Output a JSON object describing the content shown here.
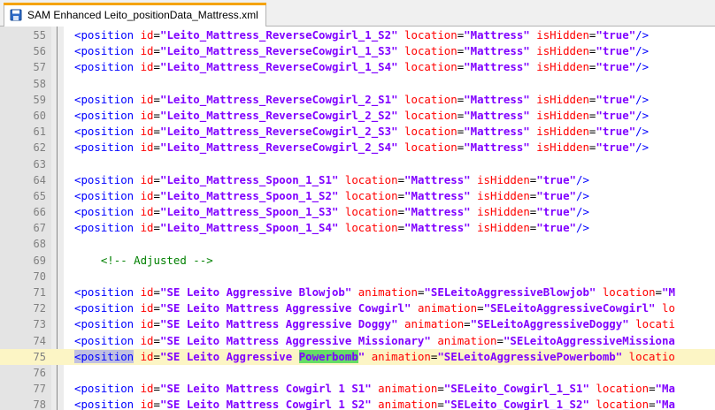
{
  "tab": {
    "title": "SAM Enhanced Leito_positionData_Mattress.xml",
    "accent_color": "#f5a300",
    "icon": "save-icon"
  },
  "colors": {
    "tag": "#0000ff",
    "attribute": "#ff0000",
    "value": "#8000ff",
    "comment": "#008000",
    "current_line": "#fcf5c5",
    "search_highlight": "#66dd66",
    "selection": "#c0c0e0"
  },
  "editor": {
    "lines": [
      {
        "n": "55",
        "type": "pos",
        "id": "\"Leito_Mattress_ReverseCowgirl_1_S2\"",
        "loc": "\"Mattress\"",
        "hidden": "\"true\"",
        "end": "/>"
      },
      {
        "n": "56",
        "type": "pos",
        "id": "\"Leito_Mattress_ReverseCowgirl_1_S3\"",
        "loc": "\"Mattress\"",
        "hidden": "\"true\"",
        "end": "/>"
      },
      {
        "n": "57",
        "type": "pos",
        "id": "\"Leito_Mattress_ReverseCowgirl_1_S4\"",
        "loc": "\"Mattress\"",
        "hidden": "\"true\"",
        "end": "/>"
      },
      {
        "n": "58",
        "type": "blank"
      },
      {
        "n": "59",
        "type": "pos",
        "id": "\"Leito_Mattress_ReverseCowgirl_2_S1\"",
        "loc": "\"Mattress\"",
        "hidden": "\"true\"",
        "end": "/>"
      },
      {
        "n": "60",
        "type": "pos",
        "id": "\"Leito_Mattress_ReverseCowgirl_2_S2\"",
        "loc": "\"Mattress\"",
        "hidden": "\"true\"",
        "end": "/>"
      },
      {
        "n": "61",
        "type": "pos",
        "id": "\"Leito_Mattress_ReverseCowgirl_2_S3\"",
        "loc": "\"Mattress\"",
        "hidden": "\"true\"",
        "end": "/>"
      },
      {
        "n": "62",
        "type": "pos",
        "id": "\"Leito_Mattress_ReverseCowgirl_2_S4\"",
        "loc": "\"Mattress\"",
        "hidden": "\"true\"",
        "end": "/>"
      },
      {
        "n": "63",
        "type": "blank"
      },
      {
        "n": "64",
        "type": "pos",
        "id": "\"Leito_Mattress_Spoon_1_S1\"",
        "loc": "\"Mattress\"",
        "hidden": "\"true\"",
        "end": "/>"
      },
      {
        "n": "65",
        "type": "pos",
        "id": "\"Leito_Mattress_Spoon_1_S2\"",
        "loc": "\"Mattress\"",
        "hidden": "\"true\"",
        "end": "/>"
      },
      {
        "n": "66",
        "type": "pos",
        "id": "\"Leito_Mattress_Spoon_1_S3\"",
        "loc": "\"Mattress\"",
        "hidden": "\"true\"",
        "end": "/>"
      },
      {
        "n": "67",
        "type": "pos",
        "id": "\"Leito_Mattress_Spoon_1_S4\"",
        "loc": "\"Mattress\"",
        "hidden": "\"true\"",
        "end": "/>"
      },
      {
        "n": "68",
        "type": "blank"
      },
      {
        "n": "69",
        "type": "comment",
        "text": "    <!-- Adjusted -->"
      },
      {
        "n": "70",
        "type": "blank"
      },
      {
        "n": "71",
        "type": "anim",
        "id": "\"SE Leito Aggressive Blowjob\"",
        "anim": "\"SELeitoAggressiveBlowjob\"",
        "loc": "\"M"
      },
      {
        "n": "72",
        "type": "anim",
        "id": "\"SE Leito Mattress Aggressive Cowgirl\"",
        "anim": "\"SELeitoAggressiveCowgirl\"",
        "loc": ""
      },
      {
        "n": "73",
        "type": "anim",
        "id": "\"SE Leito Mattress Aggressive Doggy\"",
        "anim": "\"SELeitoAggressiveDoggy\"",
        "loc": ""
      },
      {
        "n": "74",
        "type": "anim",
        "id": "\"SE Leito Mattress Aggressive Missionary\"",
        "anim": "\"SELeitoAggressiveMissiona",
        "loc": null
      },
      {
        "n": "75",
        "type": "current",
        "id_pre": "\"SE Leito Aggressive ",
        "id_hl": "Powerbomb",
        "id_post": "\"",
        "anim": "\"SELeitoAggressivePowerbomb\"",
        "loc": ""
      },
      {
        "n": "76",
        "type": "blank"
      },
      {
        "n": "77",
        "type": "anim",
        "id": "\"SE Leito Mattress Cowgirl 1 S1\"",
        "anim": "\"SELeito_Cowgirl_1_S1\"",
        "loc": "\"Ma"
      },
      {
        "n": "78",
        "type": "anim",
        "id": "\"SE Leito Mattress Cowgirl 1 S2\"",
        "anim": "\"SELeito_Cowgirl_1_S2\"",
        "loc": "\"Ma"
      }
    ],
    "overflow_attrs": {
      "72": "lo",
      "73": "locati",
      "75": "locatio"
    }
  }
}
